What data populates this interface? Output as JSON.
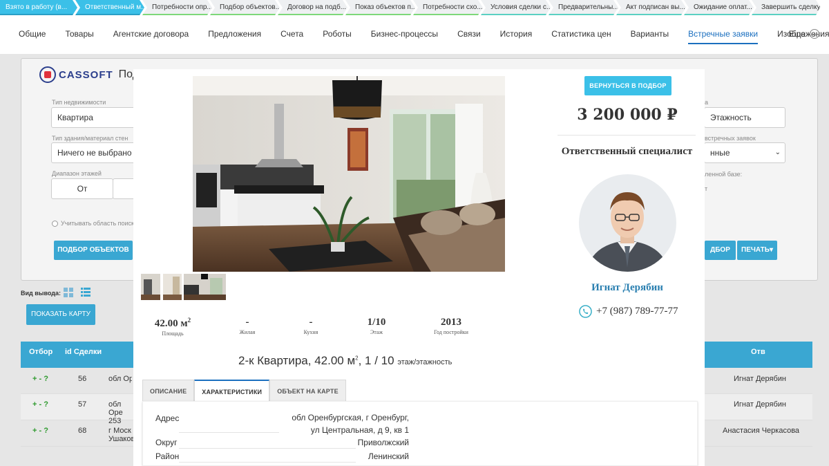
{
  "stages": [
    {
      "label": "Взято в работу (в...",
      "state": "done"
    },
    {
      "label": "Ответственный м...",
      "state": "done"
    },
    {
      "label": "Потребности опр...",
      "state": "todo"
    },
    {
      "label": "Подбор объектов...",
      "state": "todo"
    },
    {
      "label": "Договор на подб...",
      "state": "todo"
    },
    {
      "label": "Показ объектов п...",
      "state": "todo"
    },
    {
      "label": "Потребности схо...",
      "state": "todo"
    },
    {
      "label": "Условия сделки с...",
      "state": "todo"
    },
    {
      "label": "Предварительны...",
      "state": "todo"
    },
    {
      "label": "Акт подписан вы...",
      "state": "todo"
    },
    {
      "label": "Ожидание оплат...",
      "state": "todo"
    },
    {
      "label": "Завершить сделку",
      "state": "todo"
    }
  ],
  "tabs": [
    "Общие",
    "Товары",
    "Агентские договора",
    "Предложения",
    "Счета",
    "Роботы",
    "Бизнес-процессы",
    "Связи",
    "История",
    "Статистика цен",
    "Варианты",
    "Встречные заявки",
    "Изображения"
  ],
  "active_tab": "Встречные заявки",
  "tab_more": "Еще",
  "background": {
    "logo_text": "CASSOFT",
    "logo_suffix": "Под",
    "label_property_type": "Тип недвижимости",
    "property_type_value": "Квартира",
    "label_building_type": "Тип здания/материал стен",
    "building_type_value": "Ничего не выбрано",
    "label_floor_range": "Диапазон этажей",
    "floor_from": "От",
    "label_right_1": "а",
    "right_field_1": "Этажность",
    "label_right_2": "встречных заявок",
    "right_field_2": "нные",
    "label_right_3": "ленной базе:",
    "label_right_4": "т",
    "radio_label": "Учитывать область поиск",
    "btn_select_objects": "ПОДБОР ОБЪЕКТОВ",
    "btn_right_select": "ДБОР",
    "btn_print": "ПЕЧАТЬ",
    "view_label": "Вид вывода:",
    "btn_show_map": "ПОКАЗАТЬ КАРТУ",
    "table_headers": {
      "select": "Отбор",
      "deal_id": "id Сделки",
      "responsible": "Отв"
    },
    "rows": [
      {
        "actions": "+ - ?",
        "id": "56",
        "addr": "обл Оре",
        "responsible": "Игнат Дерябин"
      },
      {
        "actions": "+ - ?",
        "id": "57",
        "addr": "обл Оре 253",
        "responsible": "Игнат Дерябин"
      },
      {
        "actions": "+ - ?",
        "id": "68",
        "addr": "г Моск Ушаков",
        "responsible": "Анастасия Черкасова"
      }
    ]
  },
  "modal": {
    "back_button": "ВЕРНУТЬСЯ В ПОДБОР",
    "price": "3 200 000 ₽",
    "specialist_title": "Ответственный специалист",
    "agent_name": "Игнат Дерябин",
    "agent_phone": "+7 (987) 789-77-77",
    "stats": [
      {
        "value": "42.00 м",
        "sup": "2",
        "label": "Площадь"
      },
      {
        "value": "-",
        "sup": "",
        "label": "Жилая"
      },
      {
        "value": "-",
        "sup": "",
        "label": "Кухня"
      },
      {
        "value": "1/10",
        "sup": "",
        "label": "Этаж"
      },
      {
        "value": "2013",
        "sup": "",
        "label": "Год постройки"
      }
    ],
    "summary_main": "2-к Квартира, 42.00 м",
    "summary_sup": "2",
    "summary_floor": ", 1 / 10",
    "summary_small": "этаж/этажность",
    "tabs": [
      "ОПИСАНИЕ",
      "ХАРАКТЕРИСТИКИ",
      "ОБЪЕКТ НА КАРТЕ"
    ],
    "active_tab": "ХАРАКТЕРИСТИКИ",
    "properties": [
      {
        "label": "Адрес",
        "value_line1": "обл Оренбургская, г Оренбург,",
        "value_line2": "ул Центральная, д 9, кв 1"
      },
      {
        "label": "Округ",
        "value_line1": "Приволжский",
        "value_line2": ""
      },
      {
        "label": "Район",
        "value_line1": "Ленинский",
        "value_line2": ""
      }
    ]
  },
  "colors": {
    "accent": "#3bc0e8",
    "link": "#1b6fbf",
    "table_head": "#3aa7d2"
  }
}
